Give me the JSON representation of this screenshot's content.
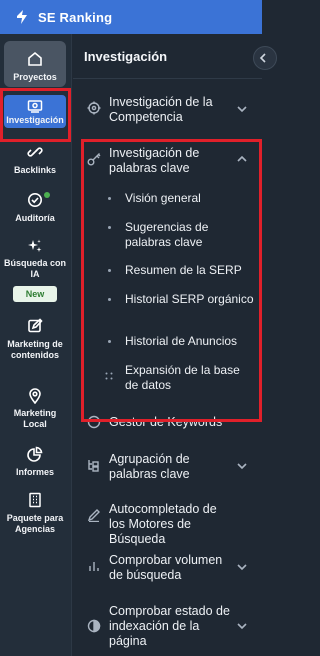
{
  "brand": {
    "name": "SE Ranking"
  },
  "rail": {
    "items": [
      {
        "label": "Proyectos"
      },
      {
        "label": "Investigación"
      },
      {
        "label": "Backlinks"
      },
      {
        "label": "Auditoría"
      },
      {
        "label": "Búsqueda con IA"
      },
      {
        "label": "Marketing de contenidos"
      },
      {
        "label": "Marketing Local"
      },
      {
        "label": "Informes"
      },
      {
        "label": "Paquete para Agencias"
      }
    ],
    "new_badge": "New"
  },
  "panel": {
    "title": "Investigación",
    "sections": [
      {
        "label": "Investigación de la Competencia",
        "expanded": false
      },
      {
        "label": "Investigación de palabras clave",
        "expanded": true,
        "children": [
          "Visión general",
          "Sugerencias de palabras clave",
          "Resumen de la SERP",
          "Historial SERP orgánico",
          "Historial de Anuncios",
          "Expansión de la base de datos"
        ]
      },
      {
        "label": "Gestor de Keywords",
        "expanded": false
      },
      {
        "label": "Agrupación de palabras clave",
        "expanded": false
      },
      {
        "label": "Autocompletado de los Motores de Búsqueda",
        "expanded": false
      },
      {
        "label": "Comprobar volumen de búsqueda",
        "expanded": false
      },
      {
        "label": "Comprobar estado de indexación de la página",
        "expanded": false
      }
    ]
  },
  "colors": {
    "brand_blue": "#3b73d6",
    "highlight_red": "#e0202a",
    "status_green": "#4caf50"
  }
}
